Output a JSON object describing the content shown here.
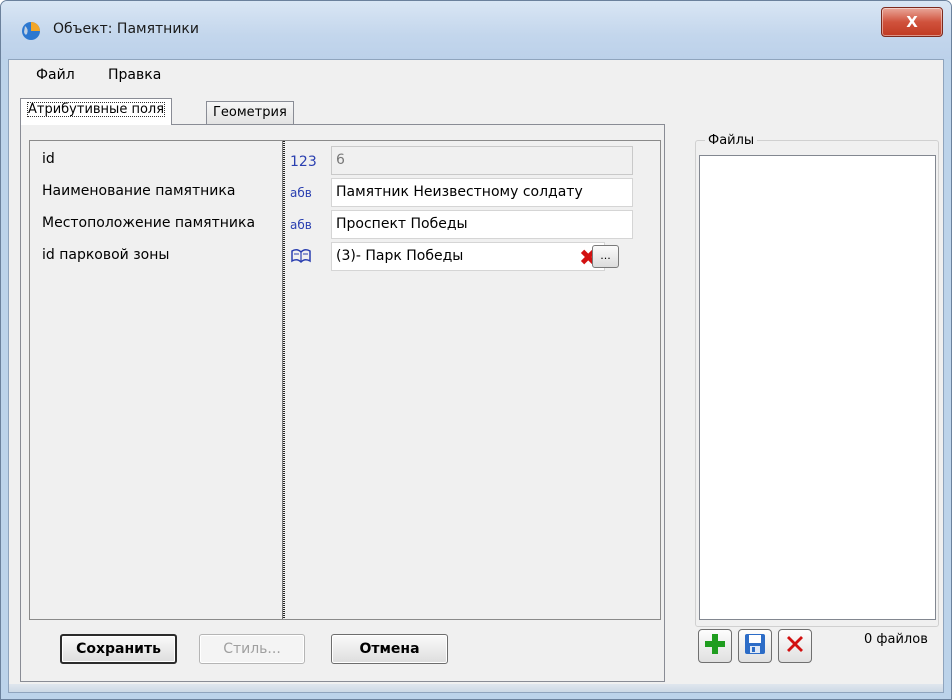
{
  "window": {
    "title": "Объект: Памятники",
    "close_label": "X"
  },
  "menu": {
    "items": [
      "Файл",
      "Правка"
    ]
  },
  "tabs": [
    "Атрибутивные поля",
    "Геометрия"
  ],
  "attributes": [
    {
      "label": "id",
      "type_icon": "123",
      "value": "6",
      "readonly": true
    },
    {
      "label": "Наименование памятника",
      "type_icon": "абв",
      "value": "Памятник Неизвестному солдату"
    },
    {
      "label": "Местоположение памятника",
      "type_icon": "абв",
      "value": "Проспект Победы"
    },
    {
      "label": "id парковой зоны",
      "type_icon": "book-lookup-icon",
      "value": "(3)- Парк Победы"
    }
  ],
  "lookup_button_label": "...",
  "buttons": {
    "save": "Сохранить",
    "style": "Стиль...",
    "cancel": "Отмена"
  },
  "files": {
    "group_title": "Файлы",
    "count_text": "0 файлов"
  },
  "colors": {
    "title_bar": "#c3d6ec",
    "close_button": "#d0523c",
    "add_green": "#1f9d1f",
    "delete_red": "#d21111",
    "save_blue": "#2c6cc7"
  }
}
